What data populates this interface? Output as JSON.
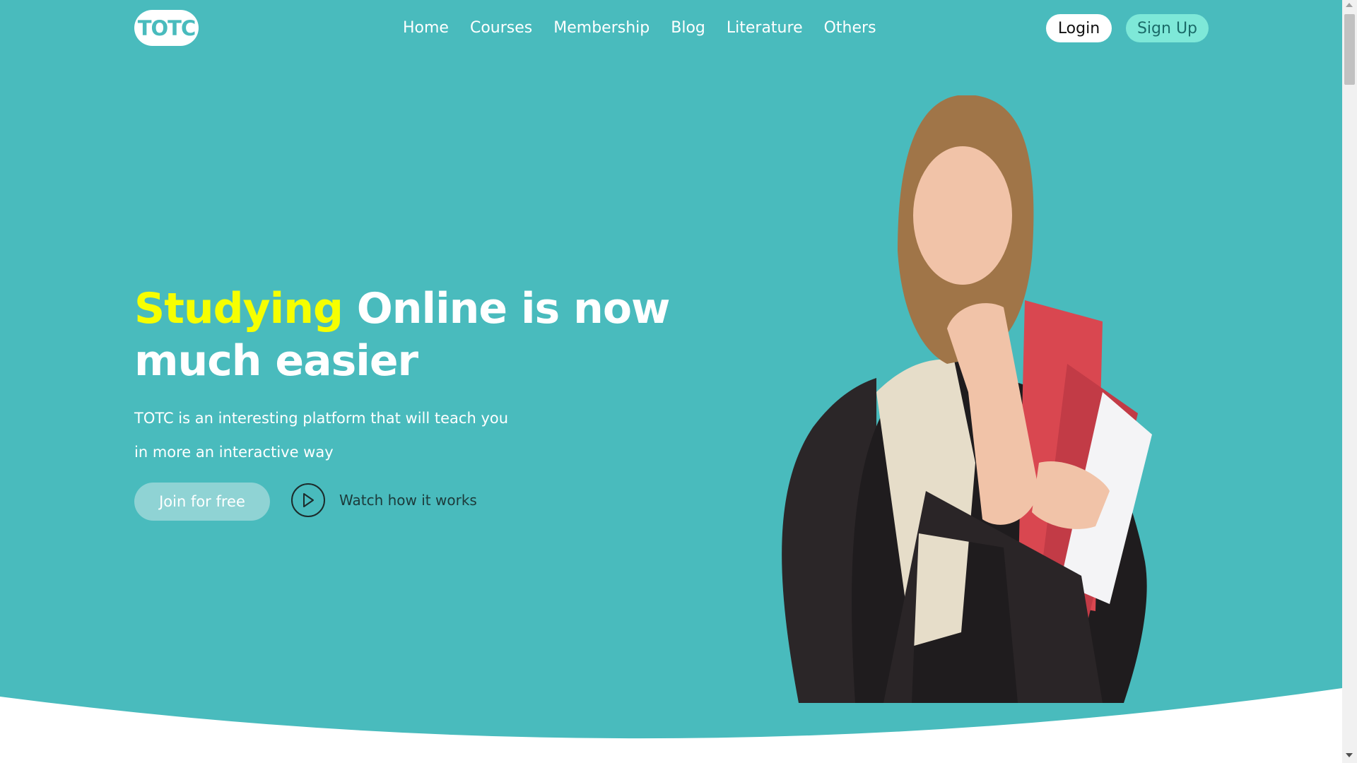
{
  "brand": {
    "logo_text": "TOTC"
  },
  "nav": {
    "items": [
      {
        "label": "Home"
      },
      {
        "label": "Courses"
      },
      {
        "label": "Membership"
      },
      {
        "label": "Blog"
      },
      {
        "label": "Literature"
      },
      {
        "label": "Others"
      }
    ]
  },
  "auth": {
    "login_label": "Login",
    "signup_label": "Sign Up"
  },
  "hero": {
    "headline_accent": "Studying",
    "headline_rest": " Online is now much easier",
    "description_line1": "TOTC is an interesting platform that will teach you",
    "description_line2": "in more an interactive way",
    "join_label": "Join for free",
    "watch_label": "Watch how it works"
  },
  "colors": {
    "hero_bg": "#49bbbd",
    "accent_yellow": "#f6ff00",
    "signup_bg": "#7ee8d8",
    "join_bg": "#8fd3d4"
  },
  "icons": {
    "play": "play-icon"
  }
}
